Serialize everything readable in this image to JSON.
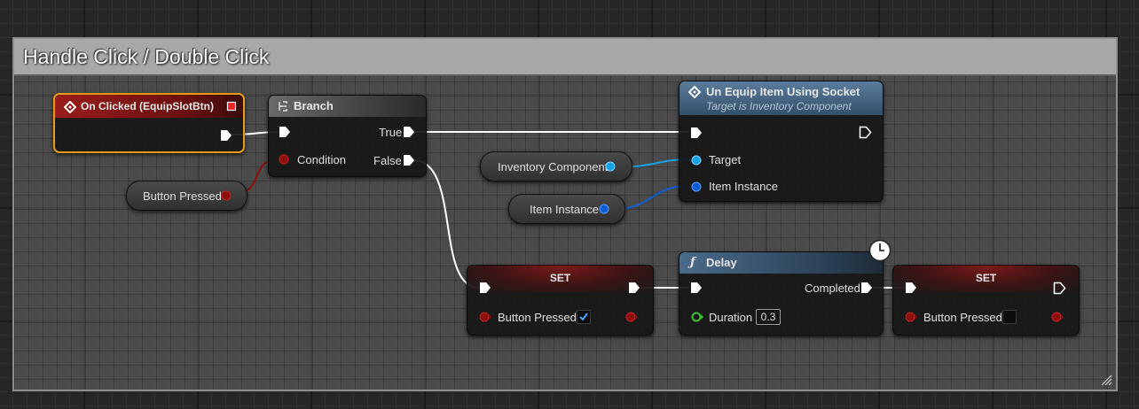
{
  "comment": {
    "title": "Handle Click / Double Click"
  },
  "nodes": {
    "on_clicked": {
      "title": "On Clicked (EquipSlotBtn)"
    },
    "branch": {
      "title": "Branch",
      "pin_condition": "Condition",
      "pin_true": "True",
      "pin_false": "False"
    },
    "unequip": {
      "title": "Un Equip Item Using Socket",
      "subtitle": "Target is Inventory Component",
      "pin_target": "Target",
      "pin_item_instance": "Item Instance"
    },
    "set_1": {
      "title": "SET",
      "pin_label": "Button Pressed",
      "checked": true
    },
    "delay": {
      "title": "Delay",
      "pin_completed": "Completed",
      "pin_duration": "Duration",
      "duration_value": "0.3"
    },
    "set_2": {
      "title": "SET",
      "pin_label": "Button Pressed",
      "checked": false
    }
  },
  "variables": {
    "button_pressed": "Button Pressed",
    "inventory_component": "Inventory Component",
    "item_instance": "Item Instance"
  },
  "colors": {
    "exec": "#ffffff",
    "bool_pin": "#8c0e0e",
    "object_pin_light": "#16a3e6",
    "object_pin_dark": "#0d5dd3",
    "float_pin": "#39c12f",
    "event_header": "#9a1c1c",
    "event_border": "#e89b14",
    "function_header": "#4a6b8a"
  },
  "icons": [
    "event-diamond-icon",
    "branch-icon",
    "function-icon",
    "latent-clock-icon",
    "checkmark-icon",
    "resize-grip-icon"
  ]
}
